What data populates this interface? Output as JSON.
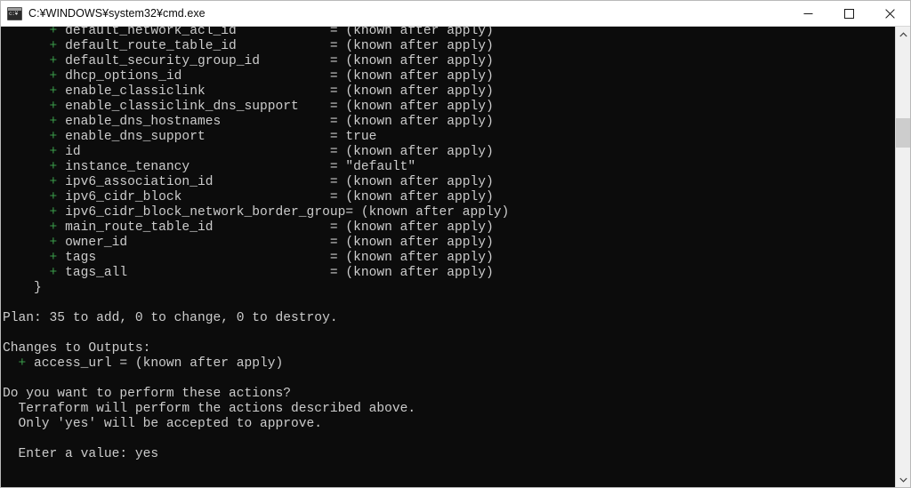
{
  "window": {
    "title": "C:¥WINDOWS¥system32¥cmd.exe",
    "icon": "cmd-console-icon",
    "colors": {
      "titlebar_bg": "#ffffff",
      "titlebar_text": "#0a0a0a",
      "console_bg": "#0c0c0c",
      "console_text": "#cccccc",
      "plus_green": "#3a9d4a",
      "scrollbar_track": "#f0f0f0",
      "scrollbar_thumb": "#cdcdcd",
      "close_hover": "#e81123"
    },
    "buttons": {
      "minimize_label": "Minimize",
      "maximize_label": "Maximize",
      "close_label": "Close"
    }
  },
  "scrollbar": {
    "up_arrow_label": "Scroll up",
    "down_arrow_label": "Scroll down",
    "thumb_label": "Scroll thumb"
  },
  "console": {
    "resource_attributes": [
      {
        "name": "default_network_acl_id",
        "value": "(known after apply)"
      },
      {
        "name": "default_route_table_id",
        "value": "(known after apply)"
      },
      {
        "name": "default_security_group_id",
        "value": "(known after apply)"
      },
      {
        "name": "dhcp_options_id",
        "value": "(known after apply)"
      },
      {
        "name": "enable_classiclink",
        "value": "(known after apply)"
      },
      {
        "name": "enable_classiclink_dns_support",
        "value": "(known after apply)"
      },
      {
        "name": "enable_dns_hostnames",
        "value": "(known after apply)"
      },
      {
        "name": "enable_dns_support",
        "value": "true"
      },
      {
        "name": "id",
        "value": "(known after apply)"
      },
      {
        "name": "instance_tenancy",
        "value": "\"default\""
      },
      {
        "name": "ipv6_association_id",
        "value": "(known after apply)"
      },
      {
        "name": "ipv6_cidr_block",
        "value": "(known after apply)"
      },
      {
        "name": "ipv6_cidr_block_network_border_group",
        "value": "(known after apply)"
      },
      {
        "name": "main_route_table_id",
        "value": "(known after apply)"
      },
      {
        "name": "owner_id",
        "value": "(known after apply)"
      },
      {
        "name": "tags",
        "value": "(known after apply)"
      },
      {
        "name": "tags_all",
        "value": "(known after apply)"
      }
    ],
    "closing_brace": "}",
    "plan_summary": "Plan: 35 to add, 0 to change, 0 to destroy.",
    "plan_counts": {
      "add": 35,
      "change": 0,
      "destroy": 0
    },
    "outputs_header": "Changes to Outputs:",
    "outputs": [
      {
        "name": "access_url",
        "value": "(known after apply)"
      }
    ],
    "prompt_question": "Do you want to perform these actions?",
    "prompt_line1": "  Terraform will perform the actions described above.",
    "prompt_line2": "  Only 'yes' will be accepted to approve.",
    "enter_value_label": "  Enter a value: ",
    "entered_value": "yes"
  }
}
